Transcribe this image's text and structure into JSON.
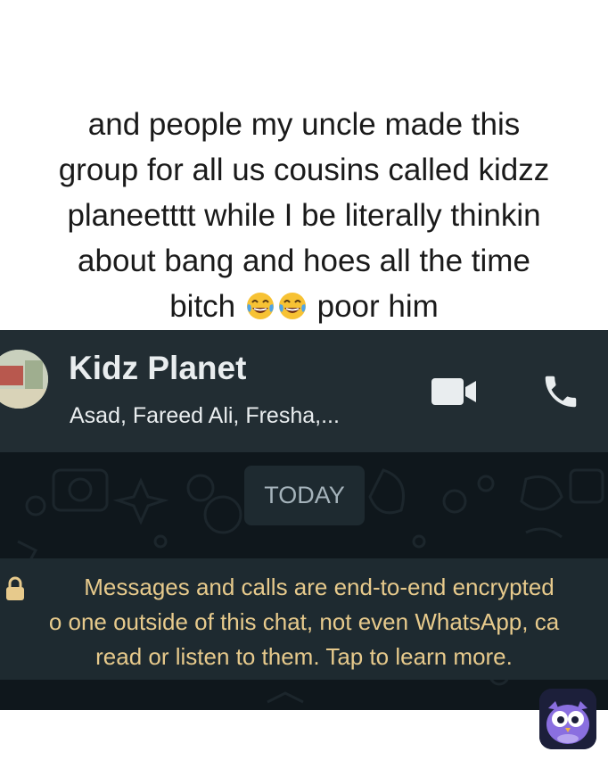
{
  "caption": {
    "line1": "and people my uncle made this",
    "line2": "group for all us cousins called kidzz",
    "line3": "planeetttt while I be literally thinkin",
    "line4": "about bang and hoes all the time",
    "line5_start": "bitch",
    "line5_emoji": [
      "face-with-tears-of-joy-icon",
      "face-with-tears-of-joy-icon"
    ],
    "line5_end": "poor him"
  },
  "chat": {
    "title": "Kidz Planet",
    "subtitle": "Asad, Fareed Ali, Fresha,...",
    "date_chip": "TODAY",
    "encryption_notice": {
      "line1": "Messages and calls are end-to-end encrypted",
      "line2": "o one outside of this chat, not even WhatsApp, ca",
      "line3": "read or listen to them. Tap to learn more."
    },
    "icons": [
      "video-call-icon",
      "voice-call-icon",
      "lock-icon"
    ]
  },
  "colors": {
    "header_bg": "#222d33",
    "chat_bg": "#0f171c",
    "banner_bg": "#1e2a30",
    "banner_text": "#e7ca8c",
    "header_text": "#e9edef",
    "date_chip_text": "#a5b3bb"
  },
  "watermark": "owl-logo-icon"
}
